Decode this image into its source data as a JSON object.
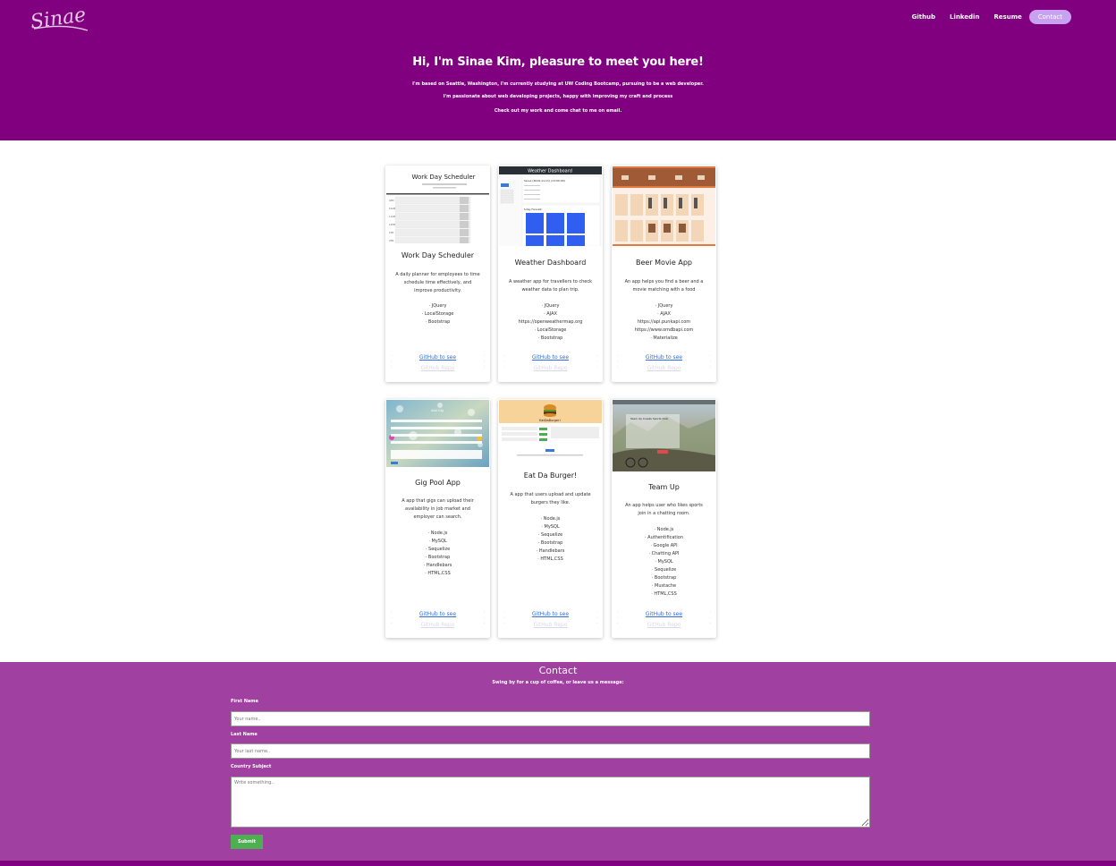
{
  "nav": {
    "logo_text": "Sinae",
    "links": [
      "Github",
      "Linkedin",
      "Resume",
      "Contact"
    ]
  },
  "hero": {
    "title": "Hi, I'm Sinae Kim, pleasure to meet you here!",
    "lines": [
      "I'm based on Seattle, Washington, I'm currently studying at UW Coding Bootcamp, pursuing to be a web developer.",
      "I'm passionate about web developing projects, happy with improving my craft and process",
      "Check out my work and come chat to me on email."
    ]
  },
  "projects": [
    {
      "title": "Work Day Scheduler",
      "desc": "A daily planner for employees to time schedule time effectively, and improve productivity.",
      "tech": [
        "JQuery",
        "LocalStorage",
        "Bootstrap"
      ],
      "link": "GitHub to see",
      "link2": "GitHub Repo",
      "shot": {
        "heading": "Work Day Scheduler",
        "hours": [
          "9AM",
          "10AM",
          "11AM",
          "12PM",
          "1PM",
          "2PM"
        ]
      }
    },
    {
      "title": "Weather Dashboard",
      "desc": "A weather app for travellers to check weather data to plan trip.",
      "tech": [
        "JQuery",
        "AJAX",
        "https://openweathermap.org",
        "LocalStorage",
        "Bootstrap"
      ],
      "link": "GitHub to see",
      "link2": "GitHub Repo",
      "shot": {
        "heading": "Weather Dashboard",
        "city": "Seoul (2019-11-11) (13:00:00)",
        "forecast_label": "5-Day Forecast:"
      }
    },
    {
      "title": "Beer Movie App",
      "desc": "An app helps you find a beer and a movie matching with a food",
      "tech": [
        "JQuery",
        "AJAX",
        "https://api.punkapi.com",
        "https://www.omdbapi.com",
        "Materialize"
      ],
      "link": "GitHub to see",
      "link2": "GitHub Repo"
    },
    {
      "title": "Gig Pool App",
      "desc": "A app that gigs can upload their availability in job market and employer can search.",
      "tech": [
        "Node.js",
        "MySQL",
        "Sequelize",
        "Bootstrap",
        "Handlebars",
        "HTML,CSS"
      ],
      "link": "GitHub to see",
      "link2": "GitHub Repo",
      "shot": {
        "heading": "Add Gig"
      }
    },
    {
      "title": "Eat Da Burger!",
      "desc": "A app that users upload and update burgers they like.",
      "tech": [
        "Node.js",
        "MySQL",
        "Sequelize",
        "Bootstrap",
        "Handlebars",
        "HTML,CSS"
      ],
      "link": "GitHub to see",
      "link2": "GitHub Repo",
      "shot": {
        "heading": "EatDaBurger!"
      }
    },
    {
      "title": "Team Up",
      "desc": "An app helps user who likes sports join in a chatting room.",
      "tech": [
        "Node.js",
        "Authentification",
        "Google API",
        "Chatting API",
        "MySQL",
        "Sequelize",
        "Bootstrap",
        "Mustache",
        "HTML,CSS"
      ],
      "link": "GitHub to see",
      "link2": "GitHub Repo",
      "shot": {
        "heading": "Team Up Create Sports Club"
      }
    }
  ],
  "contact": {
    "title": "Contact",
    "subtitle": "Swing by for a cup of coffee, or leave us a message:",
    "first_label": "First Name",
    "first_placeholder": "Your name..",
    "last_label": "Last Name",
    "last_placeholder": "Your last name..",
    "subject_label": "Country Subject",
    "subject_placeholder": "Write something..",
    "submit": "Submit"
  },
  "colors": {
    "header_bg": "#800080",
    "contact_bg": "#a040a0",
    "nav_pill": "#c7a2f0",
    "link": "#2f6ce5",
    "submit": "#4caf50"
  }
}
